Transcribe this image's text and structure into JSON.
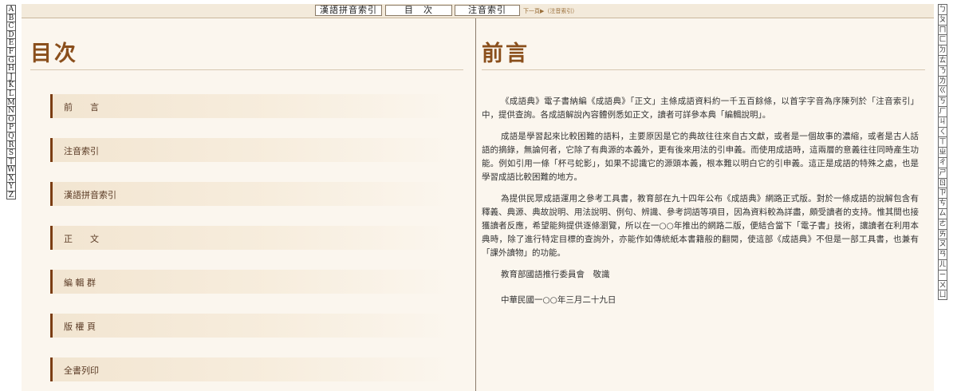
{
  "alpha_index": [
    "A",
    "B",
    "C",
    "D",
    "E",
    "F",
    "G",
    "H",
    "J",
    "K",
    "L",
    "M",
    "N",
    "O",
    "P",
    "Q",
    "R",
    "S",
    "T",
    "W",
    "X",
    "Y",
    "Z"
  ],
  "zhuyin_index": [
    "ㄅ",
    "ㄆ",
    "ㄇ",
    "ㄈ",
    "ㄉ",
    "ㄊ",
    "ㄋ",
    "ㄌ",
    "ㄍ",
    "ㄎ",
    "ㄏ",
    "ㄐ",
    "ㄑ",
    "ㄒ",
    "ㄓ",
    "ㄔ",
    "ㄕ",
    "ㄖ",
    "ㄗ",
    "ㄘ",
    "ㄙ",
    "ㄜ",
    "ㄞ",
    "ㄡ",
    "ㄢ",
    "ㄦ",
    "ㄧ",
    "ㄨ",
    "ㄩ"
  ],
  "topnav": {
    "pinyin_index": "漢語拼音索引",
    "contents": "目　次",
    "zhuyin_index": "注音索引",
    "next_page": "下一頁▶（注音索引）"
  },
  "toc": {
    "title": "目次",
    "items": [
      "前　　言",
      "注音索引",
      "漢語拼音索引",
      "正　　文",
      "編 輯 群",
      "版 權 頁",
      "全書列印"
    ]
  },
  "preface": {
    "title": "前言",
    "paragraphs": [
      "《成語典》電子書納編《成語典》「正文」主條成語資料約一千五百餘條，以首字字音為序陳列於「注音索引」中，提供查詢。各成語解說內容體例悉如正文，讀者可詳參本典「編輯說明」。",
      "成語是學習起來比較困難的語料，主要原因是它的典故往往來自古文獻，或者是一個故事的濃縮，或者是古人話語的摘錄，無論何者，它除了有典源的本義外，更有後來用法的引申義。而使用成語時，這兩層的意義往往同時產生功能。例如引用一條「杯弓蛇影」，如果不認識它的源頭本義，根本難以明白它的引申義。這正是成語的特殊之處，也是學習成語比較困難的地方。",
      "為提供民眾成語運用之參考工具書，教育部在九十四年公布《成語典》網路正式版。對於一條成語的說解包含有釋義、典源、典故說明、用法說明、例句、辨識、參考詞語等項目，因為資料較為詳盡，頗受讀者的支持。惟其間也接獲讀者反應，希望能夠提供逐條瀏覽，所以在一○○年推出的網路二版，便結合當下「電子書」技術，讓讀者在利用本典時，除了進行特定目標的查詢外，亦能作如傳統紙本書籍般的翻閱，使這部《成語典》不但是一部工具書，也兼有「課外讀物」的功能。"
    ],
    "signature": "教育部國語推行委員會　敬識",
    "date": "中華民國一○○年三月二十九日"
  }
}
